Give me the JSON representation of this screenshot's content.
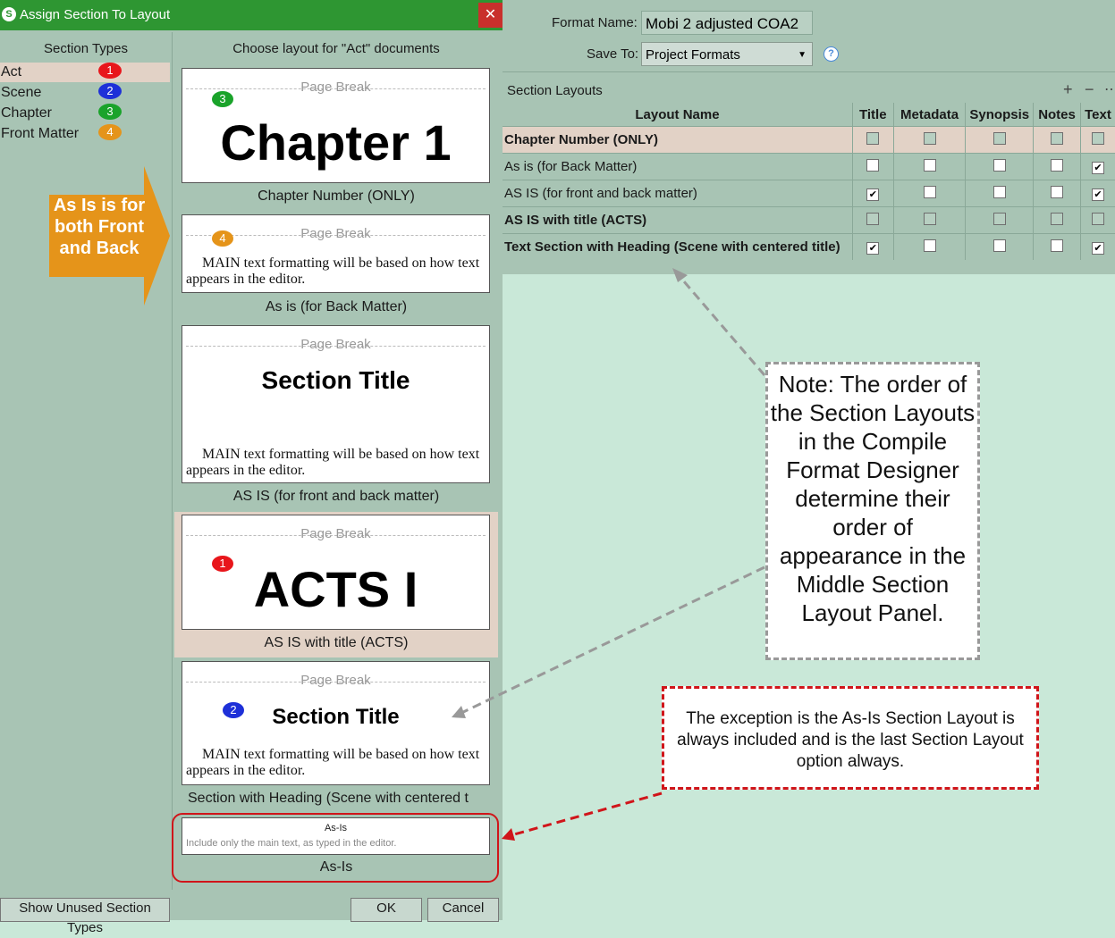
{
  "dialog": {
    "title": "Assign Section To Layout",
    "app_icon": "S",
    "close_glyph": "✕",
    "left_header": "Section Types",
    "middle_header": "Choose layout for \"Act\" documents",
    "section_types": [
      {
        "label": "Act",
        "num": "1",
        "color": "#e8161b"
      },
      {
        "label": "Scene",
        "num": "2",
        "color": "#1e30d8"
      },
      {
        "label": "Chapter",
        "num": "3",
        "color": "#1aa32a"
      },
      {
        "label": "Front Matter",
        "num": "4",
        "color": "#e5941a"
      }
    ],
    "arrow_text": "As Is is for both Front and Back",
    "page_break": "Page Break",
    "main_text": "MAIN text formatting will be based on how text appears in the editor.",
    "layouts": [
      {
        "preview": "Chapter 1",
        "caption": "Chapter Number (ONLY)",
        "badge": "3"
      },
      {
        "caption": "As is (for Back Matter)",
        "badge": "4"
      },
      {
        "preview": "Section Title",
        "caption": "AS IS (for front and back matter)"
      },
      {
        "preview": "ACTS I",
        "caption": "AS IS with title (ACTS)",
        "badge": "1"
      },
      {
        "preview": "Section Title",
        "caption": "Section with Heading (Scene with centered t",
        "badge": "2"
      }
    ],
    "asis": {
      "title": "As-Is",
      "desc": "Include only the main text, as typed in the editor.",
      "caption": "As-Is"
    },
    "show_unused": "Show Unused Section Types",
    "ok": "OK",
    "cancel": "Cancel"
  },
  "format": {
    "name_label": "Format Name:",
    "name_value": "Mobi 2 adjusted COA2",
    "save_label": "Save To:",
    "save_value": "Project Formats",
    "help_glyph": "?"
  },
  "section_layouts": {
    "label": "Section Layouts",
    "add": "+",
    "remove": "−",
    "more": "⋯",
    "columns": [
      "Layout Name",
      "Title",
      "Metadata",
      "Synopsis",
      "Notes",
      "Text"
    ],
    "rows": [
      {
        "name": "Chapter Number (ONLY)",
        "bold": true,
        "checks": [
          0,
          0,
          0,
          0,
          0
        ]
      },
      {
        "name": "As is (for Back Matter)",
        "bold": false,
        "checks": [
          0,
          0,
          0,
          0,
          1
        ]
      },
      {
        "name": "AS IS (for front and back matter)",
        "bold": false,
        "checks": [
          1,
          0,
          0,
          0,
          1
        ]
      },
      {
        "name": "AS IS with title (ACTS)",
        "bold": true,
        "checks": [
          0,
          0,
          0,
          0,
          0
        ]
      },
      {
        "name": "Text Section with Heading (Scene with centered title)",
        "bold": true,
        "checks": [
          1,
          0,
          0,
          0,
          1
        ]
      }
    ]
  },
  "notes": {
    "order": "Note: The order of the Section Layouts in the Compile Format Designer determine their order of appearance in the Middle Section Layout Panel.",
    "exception": "The exception is the As-Is Section Layout is always included and is the last Section Layout option always."
  },
  "colors": {
    "title_green": "#2e9632",
    "panel": "#a8c4b4",
    "orange": "#e5941a",
    "red": "#d0151a"
  }
}
